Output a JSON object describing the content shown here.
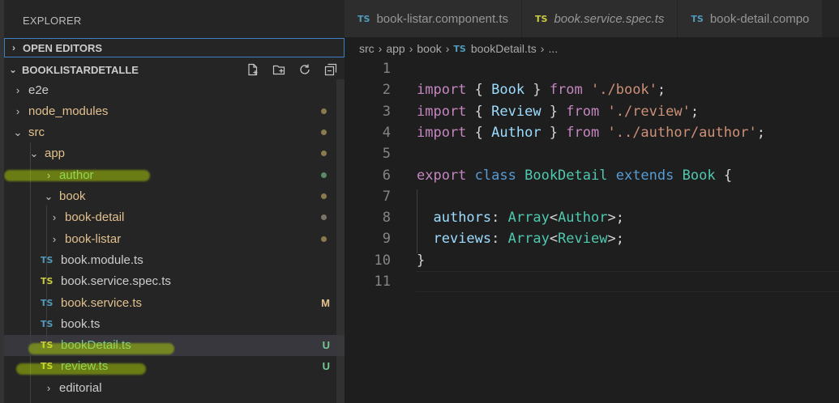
{
  "sidebar": {
    "title": "EXPLORER",
    "open_editors": "OPEN EDITORS",
    "project": "BOOKLISTARDETALLE",
    "actions": [
      "new-file-icon",
      "new-folder-icon",
      "refresh-icon",
      "collapse-all-icon"
    ],
    "tree": [
      {
        "label": "e2e",
        "type": "folder",
        "level": 1,
        "expanded": false,
        "color": "white"
      },
      {
        "label": "node_modules",
        "type": "folder",
        "level": 1,
        "expanded": false,
        "color": "yellow",
        "dot": "yellow"
      },
      {
        "label": "src",
        "type": "folder",
        "level": 1,
        "expanded": true,
        "color": "yellow",
        "dot": "yellow"
      },
      {
        "label": "app",
        "type": "folder",
        "level": 2,
        "expanded": true,
        "color": "yellow",
        "dot": "yellow"
      },
      {
        "label": "author",
        "type": "folder",
        "level": 3,
        "expanded": false,
        "color": "green",
        "dot": "green"
      },
      {
        "label": "book",
        "type": "folder",
        "level": 3,
        "expanded": true,
        "color": "yellow",
        "dot": "yellow"
      },
      {
        "label": "book-detail",
        "type": "folder",
        "level": 4,
        "expanded": false,
        "color": "yellow",
        "dot": "gray"
      },
      {
        "label": "book-listar",
        "type": "folder",
        "level": 4,
        "expanded": false,
        "color": "yellow",
        "dot": "yellow"
      },
      {
        "label": "book.module.ts",
        "type": "ts",
        "level": 4,
        "color": "white"
      },
      {
        "label": "book.service.spec.ts",
        "type": "ts-spec",
        "level": 4,
        "color": "white"
      },
      {
        "label": "book.service.ts",
        "type": "ts",
        "level": 4,
        "color": "yellow",
        "badge": "M"
      },
      {
        "label": "book.ts",
        "type": "ts",
        "level": 4,
        "color": "white"
      },
      {
        "label": "bookDetail.ts",
        "type": "ts-spec",
        "level": 4,
        "color": "green",
        "badge": "U",
        "selected": true
      },
      {
        "label": "review.ts",
        "type": "ts-spec",
        "level": 4,
        "color": "green",
        "badge": "U"
      },
      {
        "label": "editorial",
        "type": "folder",
        "level": 3,
        "expanded": false,
        "color": "white"
      }
    ]
  },
  "tabs": [
    {
      "label": "book-listar.component.ts",
      "icon": "TS",
      "icon_color": "#519aba",
      "italic": false,
      "active": false
    },
    {
      "label": "book.service.spec.ts",
      "icon": "TS",
      "icon_color": "#cbcb41",
      "italic": true,
      "active": false
    },
    {
      "label": "book-detail.compo",
      "icon": "TS",
      "icon_color": "#519aba",
      "italic": false,
      "active": false
    }
  ],
  "breadcrumb": {
    "parts": [
      "src",
      "app",
      "book"
    ],
    "file_icon": "TS",
    "file": "bookDetail.ts",
    "tail": "..."
  },
  "code": [
    {
      "n": "1",
      "tokens": []
    },
    {
      "n": "2",
      "tokens": [
        [
          "kw",
          "import"
        ],
        [
          "pun",
          " { "
        ],
        [
          "id",
          "Book"
        ],
        [
          "pun",
          " } "
        ],
        [
          "kw",
          "from"
        ],
        [
          "pun",
          " "
        ],
        [
          "str",
          "'./book'"
        ],
        [
          "pun",
          ";"
        ]
      ]
    },
    {
      "n": "3",
      "tokens": [
        [
          "kw",
          "import"
        ],
        [
          "pun",
          " { "
        ],
        [
          "id",
          "Review"
        ],
        [
          "pun",
          " } "
        ],
        [
          "kw",
          "from"
        ],
        [
          "pun",
          " "
        ],
        [
          "str",
          "'./review'"
        ],
        [
          "pun",
          ";"
        ]
      ]
    },
    {
      "n": "4",
      "tokens": [
        [
          "kw",
          "import"
        ],
        [
          "pun",
          " { "
        ],
        [
          "id",
          "Author"
        ],
        [
          "pun",
          " } "
        ],
        [
          "kw",
          "from"
        ],
        [
          "pun",
          " "
        ],
        [
          "str",
          "'../author/author'"
        ],
        [
          "pun",
          ";"
        ]
      ]
    },
    {
      "n": "5",
      "tokens": []
    },
    {
      "n": "6",
      "tokens": [
        [
          "kw",
          "export"
        ],
        [
          "pun",
          " "
        ],
        [
          "kw2",
          "class"
        ],
        [
          "pun",
          " "
        ],
        [
          "cls",
          "BookDetail"
        ],
        [
          "pun",
          " "
        ],
        [
          "kw2",
          "extends"
        ],
        [
          "pun",
          " "
        ],
        [
          "cls",
          "Book"
        ],
        [
          "pun",
          " {"
        ]
      ]
    },
    {
      "n": "7",
      "tokens": []
    },
    {
      "n": "8",
      "tokens": [
        [
          "pun",
          "  "
        ],
        [
          "id",
          "authors"
        ],
        [
          "pun",
          ": "
        ],
        [
          "cls",
          "Array"
        ],
        [
          "pun",
          "<"
        ],
        [
          "cls",
          "Author"
        ],
        [
          "pun",
          ">;"
        ]
      ]
    },
    {
      "n": "9",
      "tokens": [
        [
          "pun",
          "  "
        ],
        [
          "id",
          "reviews"
        ],
        [
          "pun",
          ": "
        ],
        [
          "cls",
          "Array"
        ],
        [
          "pun",
          "<"
        ],
        [
          "cls",
          "Review"
        ],
        [
          "pun",
          ">;"
        ]
      ]
    },
    {
      "n": "10",
      "tokens": [
        [
          "pun",
          "}"
        ]
      ]
    },
    {
      "n": "11",
      "tokens": []
    }
  ],
  "colors": {
    "keyword": "#c586c0",
    "storage": "#569cd6",
    "identifier": "#9cdcfe",
    "type": "#4ec9b0",
    "string": "#ce9178",
    "git_modified": "#e2c08d",
    "git_untracked": "#73c991"
  }
}
